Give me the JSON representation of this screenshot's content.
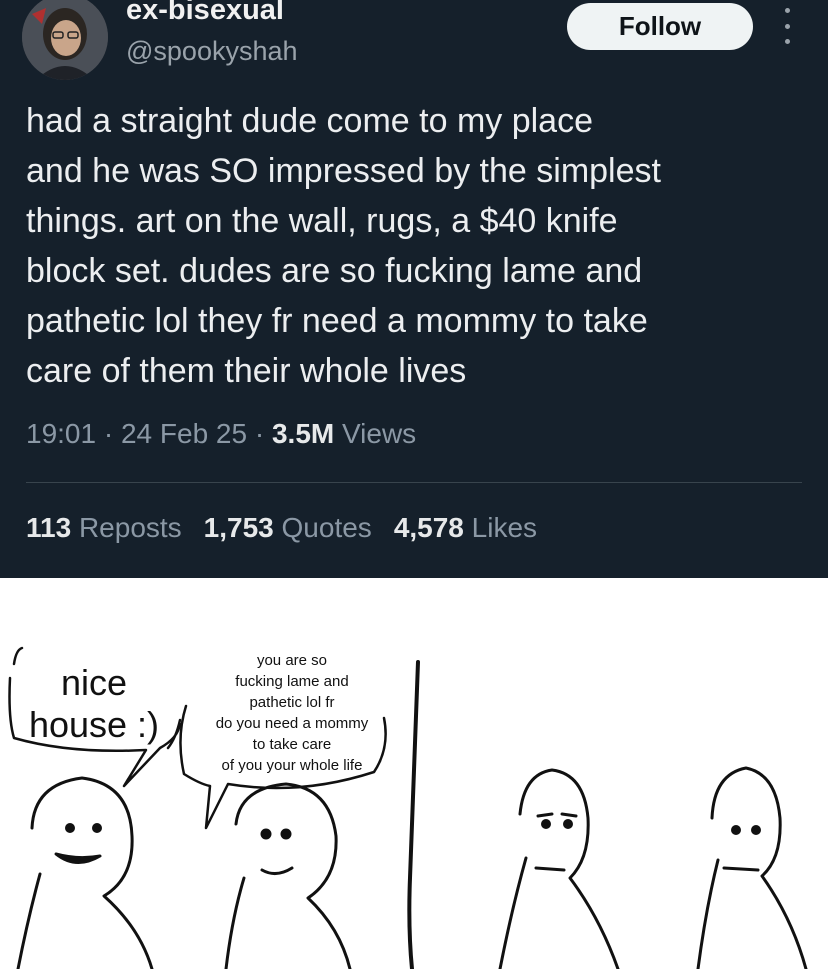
{
  "tweet": {
    "display_name": "ex-bisexual",
    "handle": "@spookyshah",
    "follow_label": "Follow",
    "text_lines": [
      "had a straight dude come to my place",
      "and he was SO impressed by the simplest",
      "things. art on the wall, rugs, a $40 knife",
      "block set. dudes are so fucking lame and",
      "pathetic lol they fr need a mommy to take",
      "care of them their whole lives"
    ],
    "time": "19:01",
    "date": "24 Feb 25",
    "views_count": "3.5M",
    "views_label": "Views",
    "reposts_count": "113",
    "reposts_label": "Reposts",
    "quotes_count": "1,753",
    "quotes_label": "Quotes",
    "likes_count": "4,578",
    "likes_label": "Likes",
    "colors": {
      "background": "#15202b",
      "text": "#e7e9ea",
      "muted": "#8b98a5",
      "button": "#eff3f4"
    },
    "icons": [
      "avatar",
      "more-icon"
    ]
  },
  "comic": {
    "speech_1_lines": [
      "nice",
      "house :)"
    ],
    "speech_2_lines": [
      "you are so",
      "fucking lame and",
      "pathetic lol fr",
      "do you need a mommy",
      "to take care",
      "of you your whole life"
    ]
  }
}
